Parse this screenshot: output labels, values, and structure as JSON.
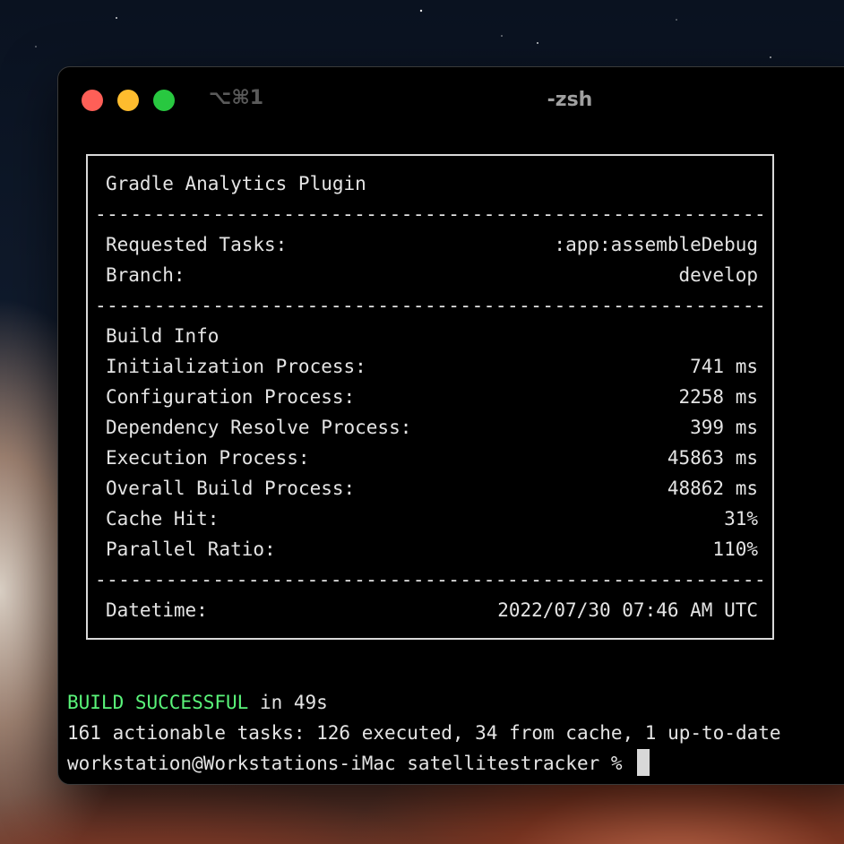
{
  "window": {
    "shortcut": "⌥⌘1",
    "title": "-zsh",
    "colors": {
      "close": "#fe5f57",
      "minimize": "#febc2e",
      "maximize": "#28c840"
    }
  },
  "report": {
    "heading": "Gradle Analytics Plugin",
    "separator": "-------------------------------------------------------------------",
    "requested_tasks_label": "Requested Tasks:",
    "requested_tasks_value": ":app:assembleDebug",
    "branch_label": "Branch:",
    "branch_value": "develop",
    "build_info_heading": "Build Info",
    "metrics": [
      {
        "label": "Initialization Process:",
        "value": "741 ms"
      },
      {
        "label": "Configuration Process:",
        "value": "2258 ms"
      },
      {
        "label": "Dependency Resolve Process:",
        "value": "399 ms"
      },
      {
        "label": "Execution Process:",
        "value": "45863 ms"
      },
      {
        "label": "Overall Build Process:",
        "value": "48862 ms"
      },
      {
        "label": "Cache Hit:",
        "value": "31%"
      },
      {
        "label": "Parallel Ratio:",
        "value": "110%"
      }
    ],
    "datetime_label": "Datetime:",
    "datetime_value": "2022/07/30 07:46 AM UTC"
  },
  "console": {
    "build_status": "BUILD SUCCESSFUL",
    "build_time": " in 49s",
    "tasks_summary": "161 actionable tasks: 126 executed, 34 from cache, 1 up-to-date",
    "prompt": "workstation@Workstations-iMac satellitestracker % "
  },
  "status_color": "#5af57a"
}
